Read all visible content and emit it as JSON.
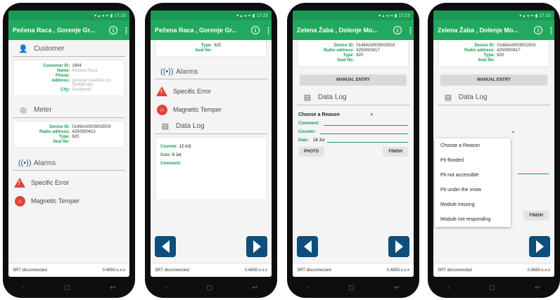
{
  "status_time": "▾ ▴ ◂ ▪▪ ▮ 17:23",
  "footer": {
    "left": "SRT disconnected",
    "right": "0.4850.x.x.x"
  },
  "phone1": {
    "title": "Pečena Raca , Gorenje Gr...",
    "customer_label": "Customer",
    "customer": [
      {
        "k": "Customer ID:",
        "v": "1904"
      },
      {
        "k": "Name:",
        "v": "Pečena Raca"
      },
      {
        "k": "Phone:",
        "v": ""
      },
      {
        "k": "Address:",
        "v": "Gorenje Gradišče pri Šentjerneju"
      },
      {
        "k": "City:",
        "v": "Šentjernej"
      }
    ],
    "meter_label": "Meter",
    "meter": [
      {
        "k": "Device ID:",
        "v": "0149AA000300200X"
      },
      {
        "k": "Radio address:",
        "v": "4250000413"
      },
      {
        "k": "Type:",
        "v": "620"
      },
      {
        "k": "Seal No:",
        "v": ""
      }
    ],
    "alarms_label": "Alarms",
    "alarm1": "Specific Error",
    "alarm2": "Magnetic Temper"
  },
  "phone2": {
    "title": "Pečena Raca , Gorenje Gr...",
    "top_lines": [
      {
        "k": "Type:",
        "v": "620"
      },
      {
        "k": "Seal No:",
        "v": ""
      }
    ],
    "alarms_label": "Alarms",
    "alarm1": "Specific Error",
    "alarm2": "Magnetic Temper",
    "datalog_label": "Data Log",
    "log": [
      {
        "k": "Counter:",
        "v": "12 m3"
      },
      {
        "k": "Date:",
        "v": "6 Jul"
      },
      {
        "k": "Comment:",
        "v": ""
      }
    ]
  },
  "phone3": {
    "title": "Zelena Žaba , Dolenje Mo...",
    "meter": [
      {
        "k": "Device ID:",
        "v": "0149AA000300200X"
      },
      {
        "k": "Radio address:",
        "v": "4250000417"
      },
      {
        "k": "Type:",
        "v": "620"
      },
      {
        "k": "Seal No:",
        "v": ""
      }
    ],
    "manual_entry": "MANUAL ENTRY",
    "datalog_label": "Data Log",
    "reason_placeholder": "Choose a Reason",
    "comment_label": "Comment:",
    "counter_label": "Counter:",
    "date_label": "Date:",
    "date_value": "18 Jul",
    "photo": "PHOTO",
    "finish": "FINISH"
  },
  "phone4": {
    "title": "Zelena Žaba , Dolenje Mo...",
    "meter": [
      {
        "k": "Device ID:",
        "v": "0149AA000300200X"
      },
      {
        "k": "Radio address:",
        "v": "4250000417"
      },
      {
        "k": "Type:",
        "v": "620"
      },
      {
        "k": "Seal No:",
        "v": ""
      }
    ],
    "manual_entry": "MANUAL ENTRY",
    "datalog_label": "Data Log",
    "finish": "FINISH",
    "options": [
      "Choose a Reason",
      "Pit flooded",
      "Pit not accessible",
      "Pit under the snow",
      "Module missing",
      "Module not responding"
    ]
  }
}
